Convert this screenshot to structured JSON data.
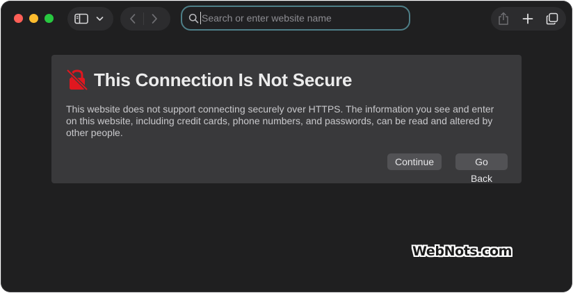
{
  "toolbar": {
    "search_placeholder": "Search or enter website name",
    "search_value": ""
  },
  "icons": {
    "sidebar": "sidebar-icon",
    "chevron": "chevron-down-icon",
    "back": "chevron-left-icon",
    "forward": "chevron-right-icon",
    "search": "search-icon",
    "share": "share-icon",
    "new_tab": "plus-icon",
    "tabs": "tab-overview-icon",
    "lock": "lock-slash-icon"
  },
  "warning": {
    "title": "This Connection Is Not Secure",
    "description": "This website does not support connecting securely over HTTPS. The information you see and enter on this website, including credit cards, phone numbers, and passwords, can be read and altered by other people.",
    "continue_label": "Continue",
    "go_back_label": "Go Back"
  },
  "watermark": "WebNots.com",
  "colors": {
    "window_bg": "#1f1f20",
    "card_bg": "#39393b",
    "search_focus": "#4e7f88",
    "lock_red": "#e0171f"
  }
}
